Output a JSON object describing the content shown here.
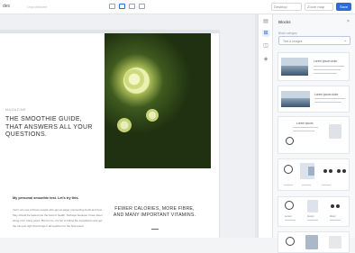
{
  "app": {
    "brand": "des",
    "status": "Unpublished"
  },
  "toolbar": {
    "view_select": "Desktop",
    "zoom_select": "Zoom map",
    "save_label": "Save"
  },
  "page": {
    "kicker": "MAGAZINE",
    "title": "THE SMOOTHIE GUIDE, THAT ANSWERS ALL YOUR QUESTIONS.",
    "subheading": "My personal smoothie test. Let's try this.",
    "body": "Yes! I am one of those people who get so eager connecting foods and how they should be tasted into the best of health. Perhaps because I have been doing it for many years. But for me, it's fun to follow the ingredients and get the mix just right that brings it all together for the final result.",
    "quote": "FEWER CALORIES, MORE FIBRE, AND MANY IMPORTANT VITAMINS."
  },
  "panel": {
    "title": "Blocks",
    "category_label": "Block category",
    "category_value": "Text & Images",
    "cards": [
      {
        "kind": "image-right",
        "title": "Lorem ipsum dolor"
      },
      {
        "kind": "image-left",
        "title": "Lorem ipsum dolor"
      },
      {
        "kind": "products",
        "title": "Lorem ipsum"
      },
      {
        "kind": "gallery"
      },
      {
        "kind": "labeled-gallery",
        "labels": [
          "Lorem",
          "Ipsum",
          "Dolor"
        ]
      },
      {
        "kind": "gallery-2"
      }
    ]
  },
  "colors": {
    "accent": "#2b6cd6"
  }
}
